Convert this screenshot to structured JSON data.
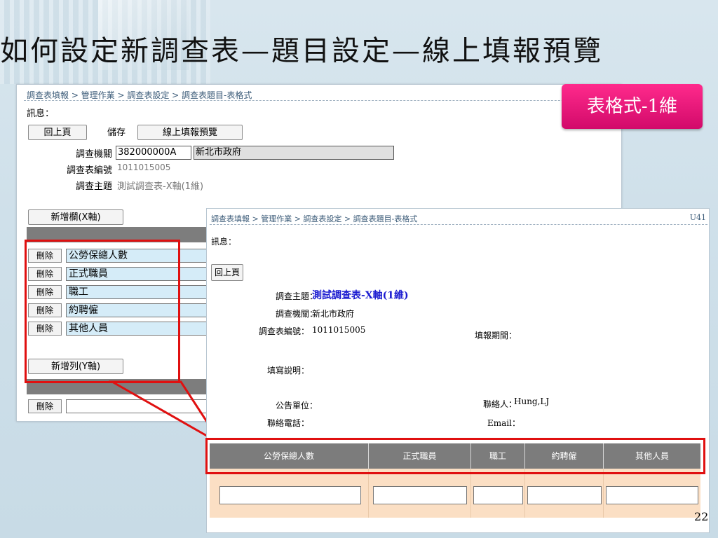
{
  "slide": {
    "title": "如何設定新調查表—題目設定—線上填報預覽",
    "badge": "表格式-1維",
    "page_number": "22"
  },
  "back_window": {
    "breadcrumb": "調查表填報 > 管理作業 > 調查表設定 > 調查表題目-表格式",
    "message_label": "訊息：",
    "buttons": {
      "back": "回上頁",
      "save": "儲存",
      "preview": "線上填報預覽"
    },
    "agency_label": "調查機關",
    "agency_code": "382000000A",
    "agency_name": "新北市政府",
    "survey_no_label": "調查表編號",
    "survey_no": "1011015005",
    "topic_label": "調查主題",
    "topic": "測試調查表-X軸(1維)",
    "add_column_button": "新增欄(X軸)",
    "add_row_button": "新增列(Y軸)",
    "delete_label": "刪除",
    "columns": [
      "公勞保總人數",
      "正式職員",
      "職工",
      "約聘僱",
      "其他人員"
    ]
  },
  "front_window": {
    "breadcrumb": "調查表填報 > 管理作業 > 調查表設定 > 調查表題目-表格式",
    "corner_code": "U41",
    "message_label": "訊息：",
    "back_button": "回上頁",
    "topic_label": "調查主題：",
    "topic": "測試調查表-X軸(1維)",
    "agency_label": "調查機關：",
    "agency": "新北市政府",
    "survey_no_label": "調查表編號：",
    "survey_no": "1011015005",
    "period_label": "填報期間：",
    "instruction_label": "填寫說明：",
    "unit_label": "公告單位：",
    "contact_label": "聯絡人：",
    "contact": "Hung,LJ",
    "phone_label": "聯絡電話：",
    "email_label": "Email：",
    "table_headers": [
      "公勞保總人數",
      "正式職員",
      "職工",
      "約聘僱",
      "其他人員"
    ]
  }
}
